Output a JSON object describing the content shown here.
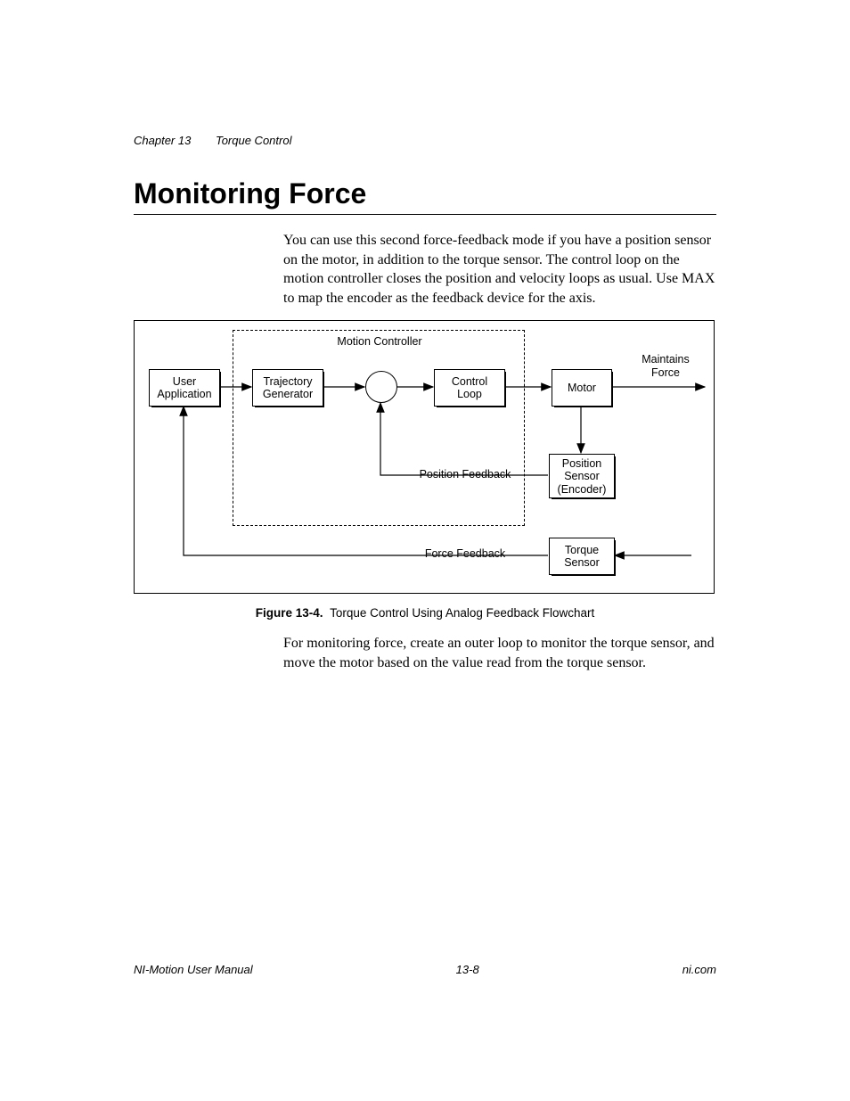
{
  "header": {
    "chapter_label": "Chapter 13",
    "chapter_title": "Torque Control"
  },
  "heading": "Monitoring Force",
  "paragraphs": {
    "p1": "You can use this second force-feedback mode if you have a position sensor on the motor, in addition to the torque sensor. The control loop on the motion controller closes the position and velocity loops as usual. Use MAX to map the encoder as the feedback device for the axis.",
    "p2": "For monitoring force, create an outer loop to monitor the torque sensor, and move the motor based on the value read from the torque sensor."
  },
  "figure": {
    "caption_num": "Figure 13-4.",
    "caption_text": "Torque Control Using Analog Feedback Flowchart",
    "labels": {
      "mc": "Motion Controller",
      "user_app_l1": "User",
      "user_app_l2": "Application",
      "traj_l1": "Trajectory",
      "traj_l2": "Generator",
      "ctrl_l1": "Control",
      "ctrl_l2": "Loop",
      "motor": "Motor",
      "maintains_l1": "Maintains",
      "maintains_l2": "Force",
      "posfb": "Position Feedback",
      "forcefb": "Force Feedback",
      "psensor_l1": "Position",
      "psensor_l2": "Sensor",
      "psensor_l3": "(Encoder)",
      "tsensor_l1": "Torque",
      "tsensor_l2": "Sensor"
    }
  },
  "footer": {
    "left": "NI-Motion User Manual",
    "center": "13-8",
    "right": "ni.com"
  }
}
